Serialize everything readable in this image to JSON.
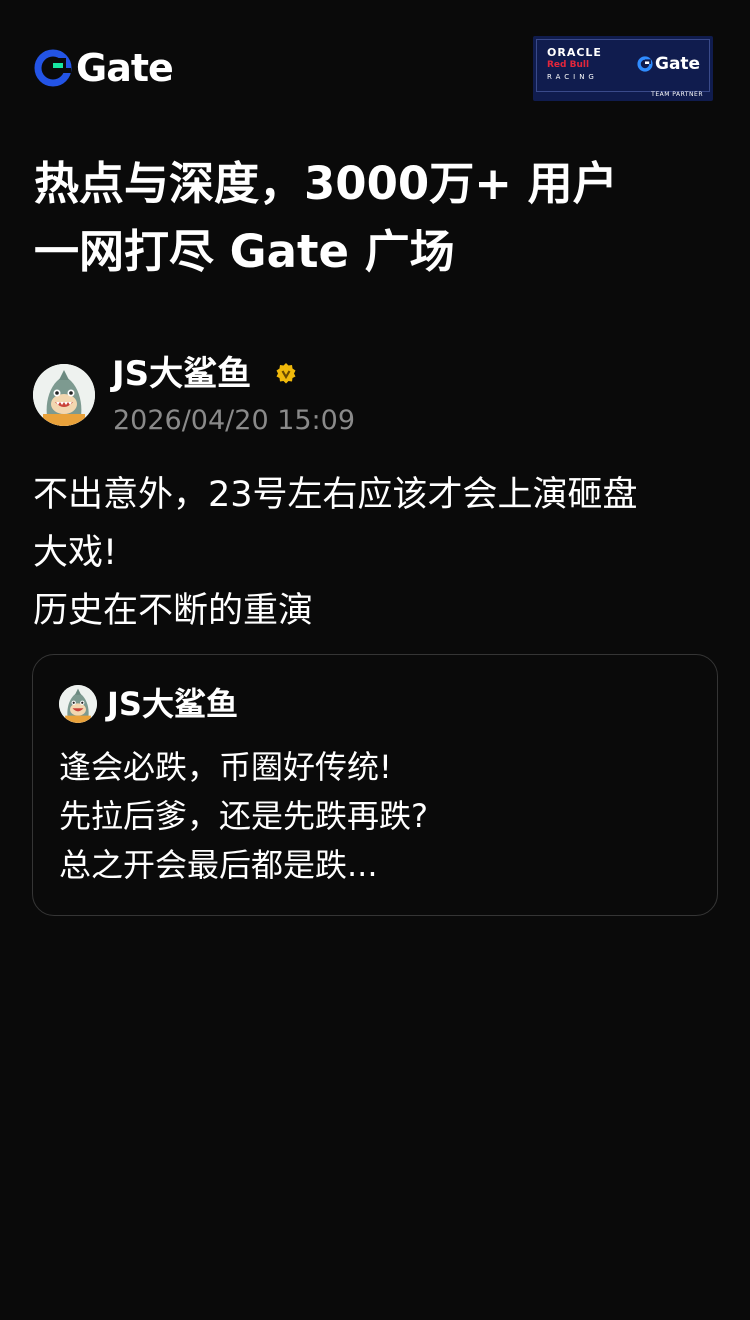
{
  "header": {
    "logo_text": "Gate",
    "logo_icon": "gate-logo-icon",
    "partner_badge": {
      "oracle": "ORACLE",
      "red_bull": "Red Bull",
      "racing": "RACING",
      "gate": "Gate",
      "label": "TEAM PARTNER"
    }
  },
  "headline": {
    "line1": "热点与深度，3000万+ 用户",
    "line2": "一网打尽 Gate 广场"
  },
  "post": {
    "author": "JS大鲨鱼",
    "verified_icon": "verified-badge-icon",
    "timestamp": "2026/04/20 15:09",
    "lines": [
      "不出意外，23号左右应该才会上演砸盘",
      "大戏!",
      "历史在不断的重演"
    ]
  },
  "quote": {
    "author": "JS大鲨鱼",
    "lines": [
      "逢会必跌，币圈好传统!",
      "先拉后爹，还是先跌再跌?",
      "总之开会最后都是跌..."
    ]
  },
  "colors": {
    "background": "#0a0a0a",
    "brand_blue": "#2354e6",
    "brand_cyan": "#17e6a1",
    "verified_gold": "#f0b90b",
    "muted_text": "#8a8a8a",
    "card_border": "#353535"
  }
}
